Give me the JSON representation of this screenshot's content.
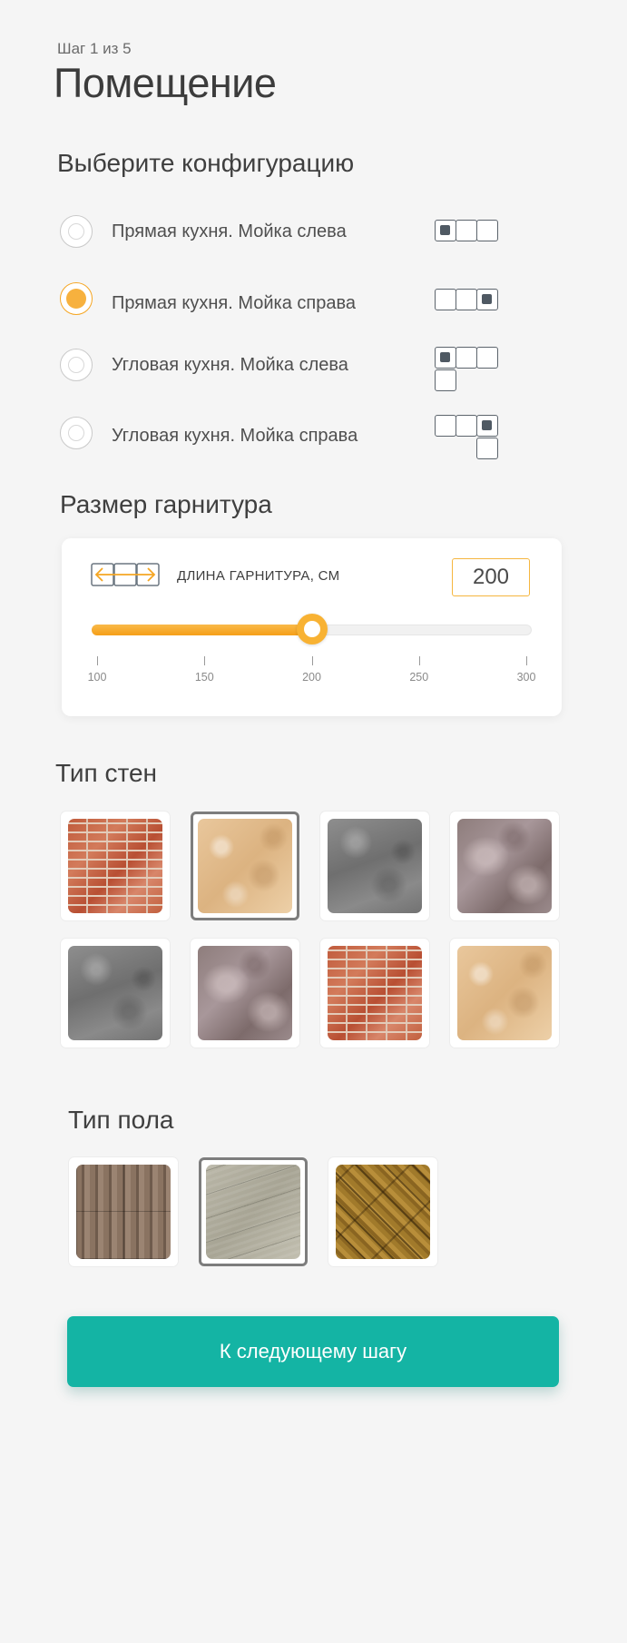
{
  "header": {
    "step": "Шаг 1 из 5",
    "title": "Помещение"
  },
  "configuration": {
    "heading": "Выберите конфигурацию",
    "options": [
      {
        "label": "Прямая кухня. Мойка слева",
        "selected": false,
        "icon": "straight-sink-left-icon"
      },
      {
        "label": "Прямая кухня. Мойка справа",
        "selected": true,
        "icon": "straight-sink-right-icon"
      },
      {
        "label": "Угловая кухня. Мойка слева",
        "selected": false,
        "icon": "corner-sink-left-icon"
      },
      {
        "label": "Угловая кухня. Мойка справа",
        "selected": false,
        "icon": "corner-sink-right-icon"
      }
    ]
  },
  "size": {
    "heading": "Размер гарнитура",
    "label": "ДЛИНА ГАРНИТУРА, СМ",
    "value": "200",
    "slider": {
      "min": 100,
      "max": 300,
      "current": 200
    },
    "ticks": [
      "100",
      "150",
      "200",
      "250",
      "300"
    ]
  },
  "walls": {
    "heading": "Тип стен",
    "selected_index": 1,
    "swatches": [
      "brick-texture",
      "beige-plaster-texture",
      "grey-concrete-texture",
      "mauve-stucco-texture",
      "grey-concrete-texture",
      "mauve-stucco-texture",
      "brick-texture",
      "beige-plaster-texture"
    ]
  },
  "floor": {
    "heading": "Тип пола",
    "selected_index": 1,
    "swatches": [
      "wood-parquet-texture",
      "grey-laminate-texture",
      "herringbone-oak-texture"
    ]
  },
  "next_button": "К следующему шагу",
  "colors": {
    "accent": "#f7b13e",
    "primary": "#14b4a4",
    "background": "#f5f5f5"
  }
}
